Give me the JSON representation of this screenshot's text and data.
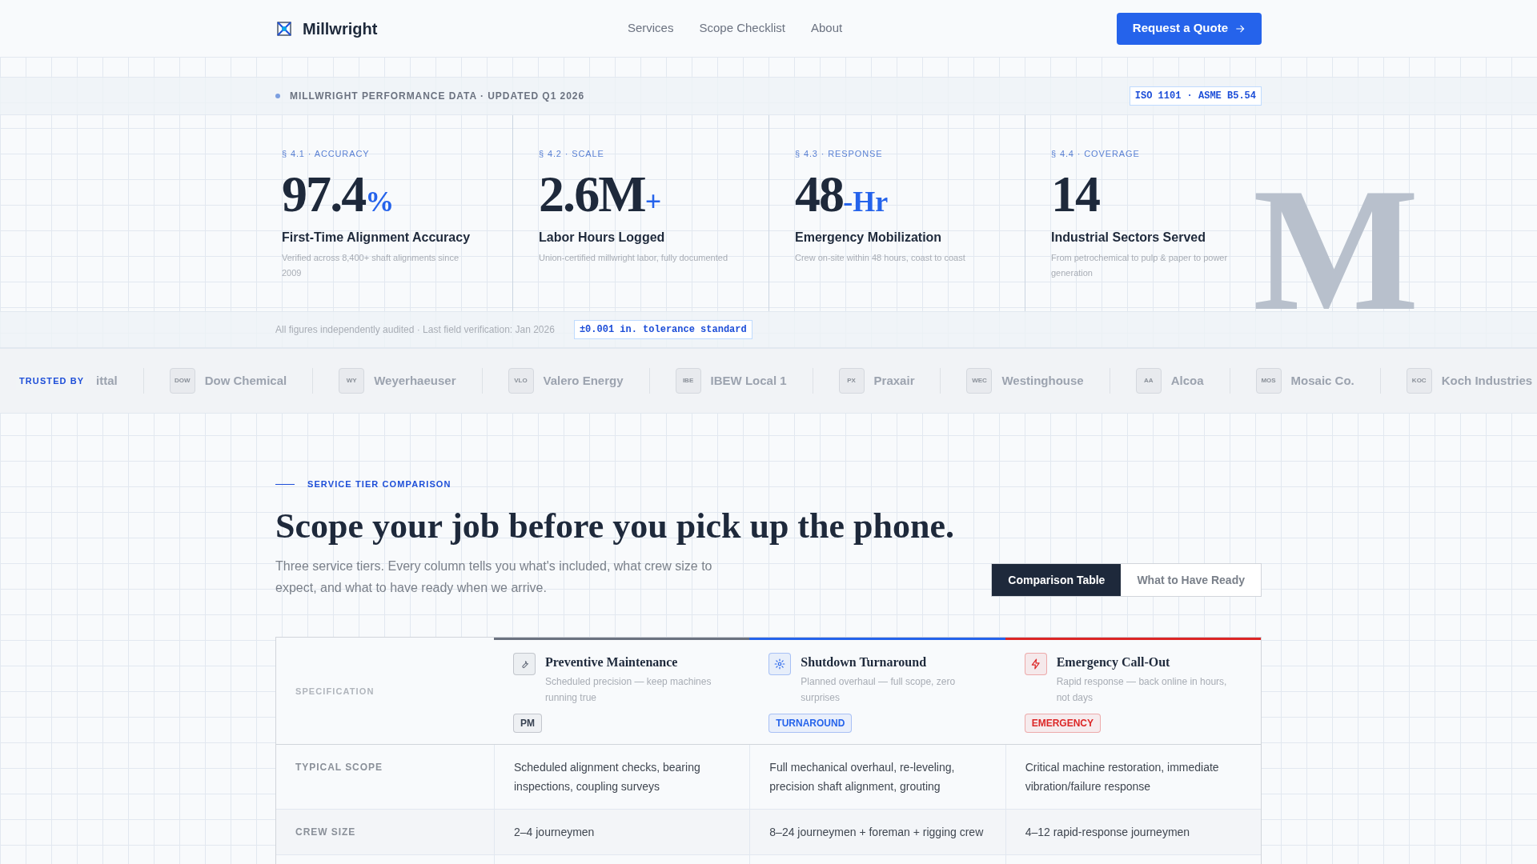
{
  "header": {
    "brand": "Millwright",
    "nav": [
      {
        "label": "Services"
      },
      {
        "label": "Scope Checklist"
      },
      {
        "label": "About"
      }
    ],
    "cta": "Request a Quote"
  },
  "stats_band": {
    "eyebrow": "MILLWRIGHT PERFORMANCE DATA · UPDATED Q1 2026",
    "standards": "ISO 1101 · ASME B5.54",
    "watermark": "M",
    "stats": [
      {
        "section": "§ 4.1 · ACCURACY",
        "value": "97.4",
        "unit": "%",
        "title": "First-Time Alignment Accuracy",
        "description": "Verified across 8,400+ shaft alignments since 2009"
      },
      {
        "section": "§ 4.2 · SCALE",
        "value": "2.6M",
        "unit": "+",
        "title": "Labor Hours Logged",
        "description": "Union-certified millwright labor, fully documented"
      },
      {
        "section": "§ 4.3 · RESPONSE",
        "value": "48",
        "unit": "-Hr",
        "title": "Emergency Mobilization",
        "description": "Crew on-site within 48 hours, coast to coast"
      },
      {
        "section": "§ 4.4 · COVERAGE",
        "value": "14",
        "title": "Industrial Sectors Served",
        "description": "From petrochemical to pulp & paper to power generation"
      }
    ],
    "footnote": "All figures independently audited · Last field verification: Jan 2026",
    "tolerance": "±0.001 in. tolerance standard"
  },
  "trusted": {
    "label": "TRUSTED BY",
    "clients": [
      {
        "name": "ittal"
      },
      {
        "abbr": "DOW",
        "name": "Dow Chemical"
      },
      {
        "abbr": "WY",
        "name": "Weyerhaeuser"
      },
      {
        "abbr": "VLO",
        "name": "Valero Energy"
      },
      {
        "abbr": "IBE",
        "name": "IBEW Local 1"
      },
      {
        "abbr": "PX",
        "name": "Praxair"
      },
      {
        "abbr": "WEC",
        "name": "Westinghouse"
      },
      {
        "abbr": "AA",
        "name": "Alcoa"
      },
      {
        "abbr": "MOS",
        "name": "Mosaic Co."
      },
      {
        "abbr": "KOC",
        "name": "Koch Industries"
      }
    ]
  },
  "comparison": {
    "eyebrow": "SERVICE TIER COMPARISON",
    "heading": "Scope your job before you pick up the phone.",
    "intro": "Three service tiers. Every column tells you what's included, what crew size to expect, and what to have ready when we arrive.",
    "tabs": [
      {
        "label": "Comparison Table",
        "selected": true
      },
      {
        "label": "What to Have Ready",
        "selected": false
      }
    ],
    "table": {
      "corner": "SPECIFICATION",
      "tiers": [
        {
          "kind": "wrench",
          "name": "Preventive Maintenance",
          "tagline": "Scheduled precision — keep machines running true",
          "badge": "PM",
          "color": "#6b7280"
        },
        {
          "kind": "gear",
          "name": "Shutdown Turnaround",
          "tagline": "Planned overhaul — full scope, zero surprises",
          "badge": "TURNAROUND",
          "color": "#2563eb"
        },
        {
          "kind": "bolt",
          "name": "Emergency Call-Out",
          "tagline": "Rapid response — back online in hours, not days",
          "badge": "EMERGENCY",
          "color": "#dc2626"
        }
      ],
      "rows": [
        {
          "label": "TYPICAL SCOPE",
          "cells": [
            "Scheduled alignment checks, bearing inspections, coupling surveys",
            "Full mechanical overhaul, re-leveling, precision shaft alignment, grouting",
            "Critical machine restoration, immediate vibration/failure response"
          ]
        },
        {
          "label": "CREW SIZE",
          "cells": [
            "2–4 journeymen",
            "8–24 journeymen + foreman + rigging crew",
            "4–12 rapid-response journeymen"
          ]
        }
      ]
    }
  }
}
